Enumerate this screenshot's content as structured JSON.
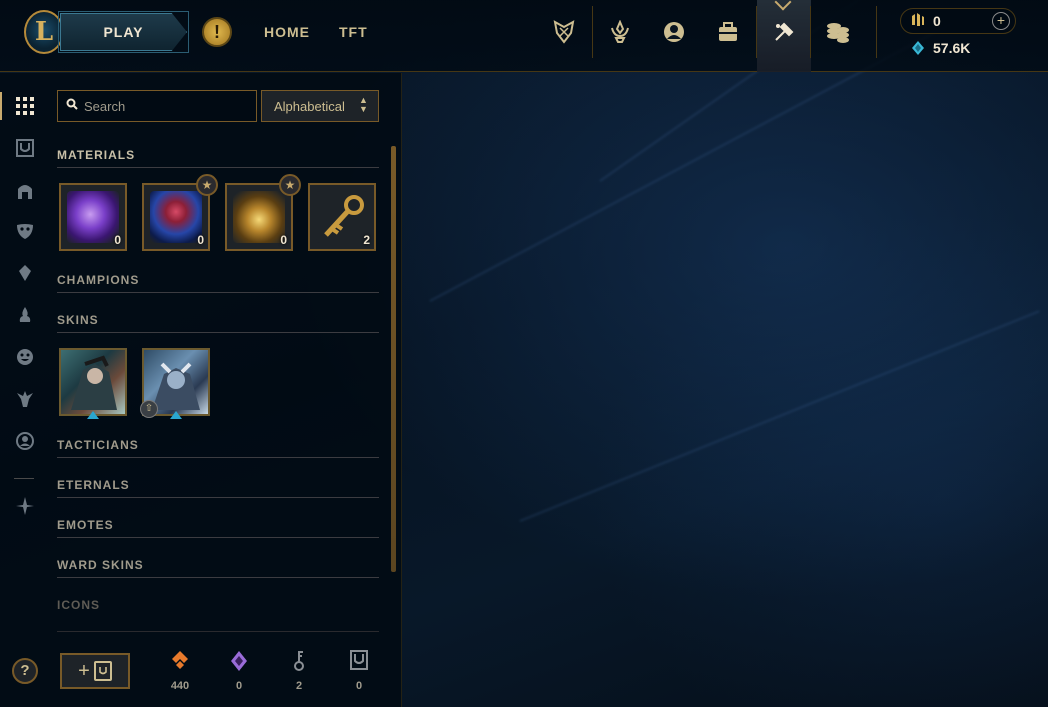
{
  "colors": {
    "gold": "#c8aa6e",
    "gold_dark": "#785a28",
    "text_light": "#f0e6d2",
    "blue_essence": "#39b8d6",
    "orange_essence": "#e77a2c",
    "mythic": "#9a6cd8"
  },
  "header": {
    "logo_letter": "L",
    "play_label": "PLAY",
    "alert_glyph": "!",
    "nav": [
      {
        "label": "HOME"
      },
      {
        "label": "TFT"
      }
    ],
    "icons": [
      "clash-icon",
      "rewards-icon",
      "profile-icon",
      "collection-icon",
      "loot-icon",
      "store-icon"
    ],
    "rp_value": "0",
    "add_rp_glyph": "+",
    "be_value": "57.6K"
  },
  "toolbar": {
    "search_placeholder": "Search",
    "sort_value": "Alphabetical"
  },
  "categories": {
    "materials": "MATERIALS",
    "champions": "CHAMPIONS",
    "skins": "SKINS",
    "tacticians": "TACTICIANS",
    "eternals": "ETERNALS",
    "emotes": "EMOTES",
    "ward_skins": "WARD SKINS",
    "icons": "ICONS"
  },
  "materials": [
    {
      "icon": "mythic-essence-icon",
      "count": "0",
      "starred": false
    },
    {
      "icon": "capsule-icon",
      "count": "0",
      "starred": true
    },
    {
      "icon": "chest-icon",
      "count": "0",
      "starred": true
    },
    {
      "icon": "key-icon",
      "count": "2",
      "starred": false
    }
  ],
  "skins": [
    {
      "icon": "skin-shard-icon",
      "upgrade": false
    },
    {
      "icon": "skin-shard-icon",
      "upgrade": true
    }
  ],
  "footer": {
    "craft_plus": "+",
    "stats": [
      {
        "icon": "orange-essence-icon",
        "value": "440"
      },
      {
        "icon": "mythic-essence-icon",
        "value": "0"
      },
      {
        "icon": "key-fragment-icon",
        "value": "2"
      },
      {
        "icon": "chest-icon",
        "value": "0"
      }
    ]
  },
  "help_glyph": "?"
}
